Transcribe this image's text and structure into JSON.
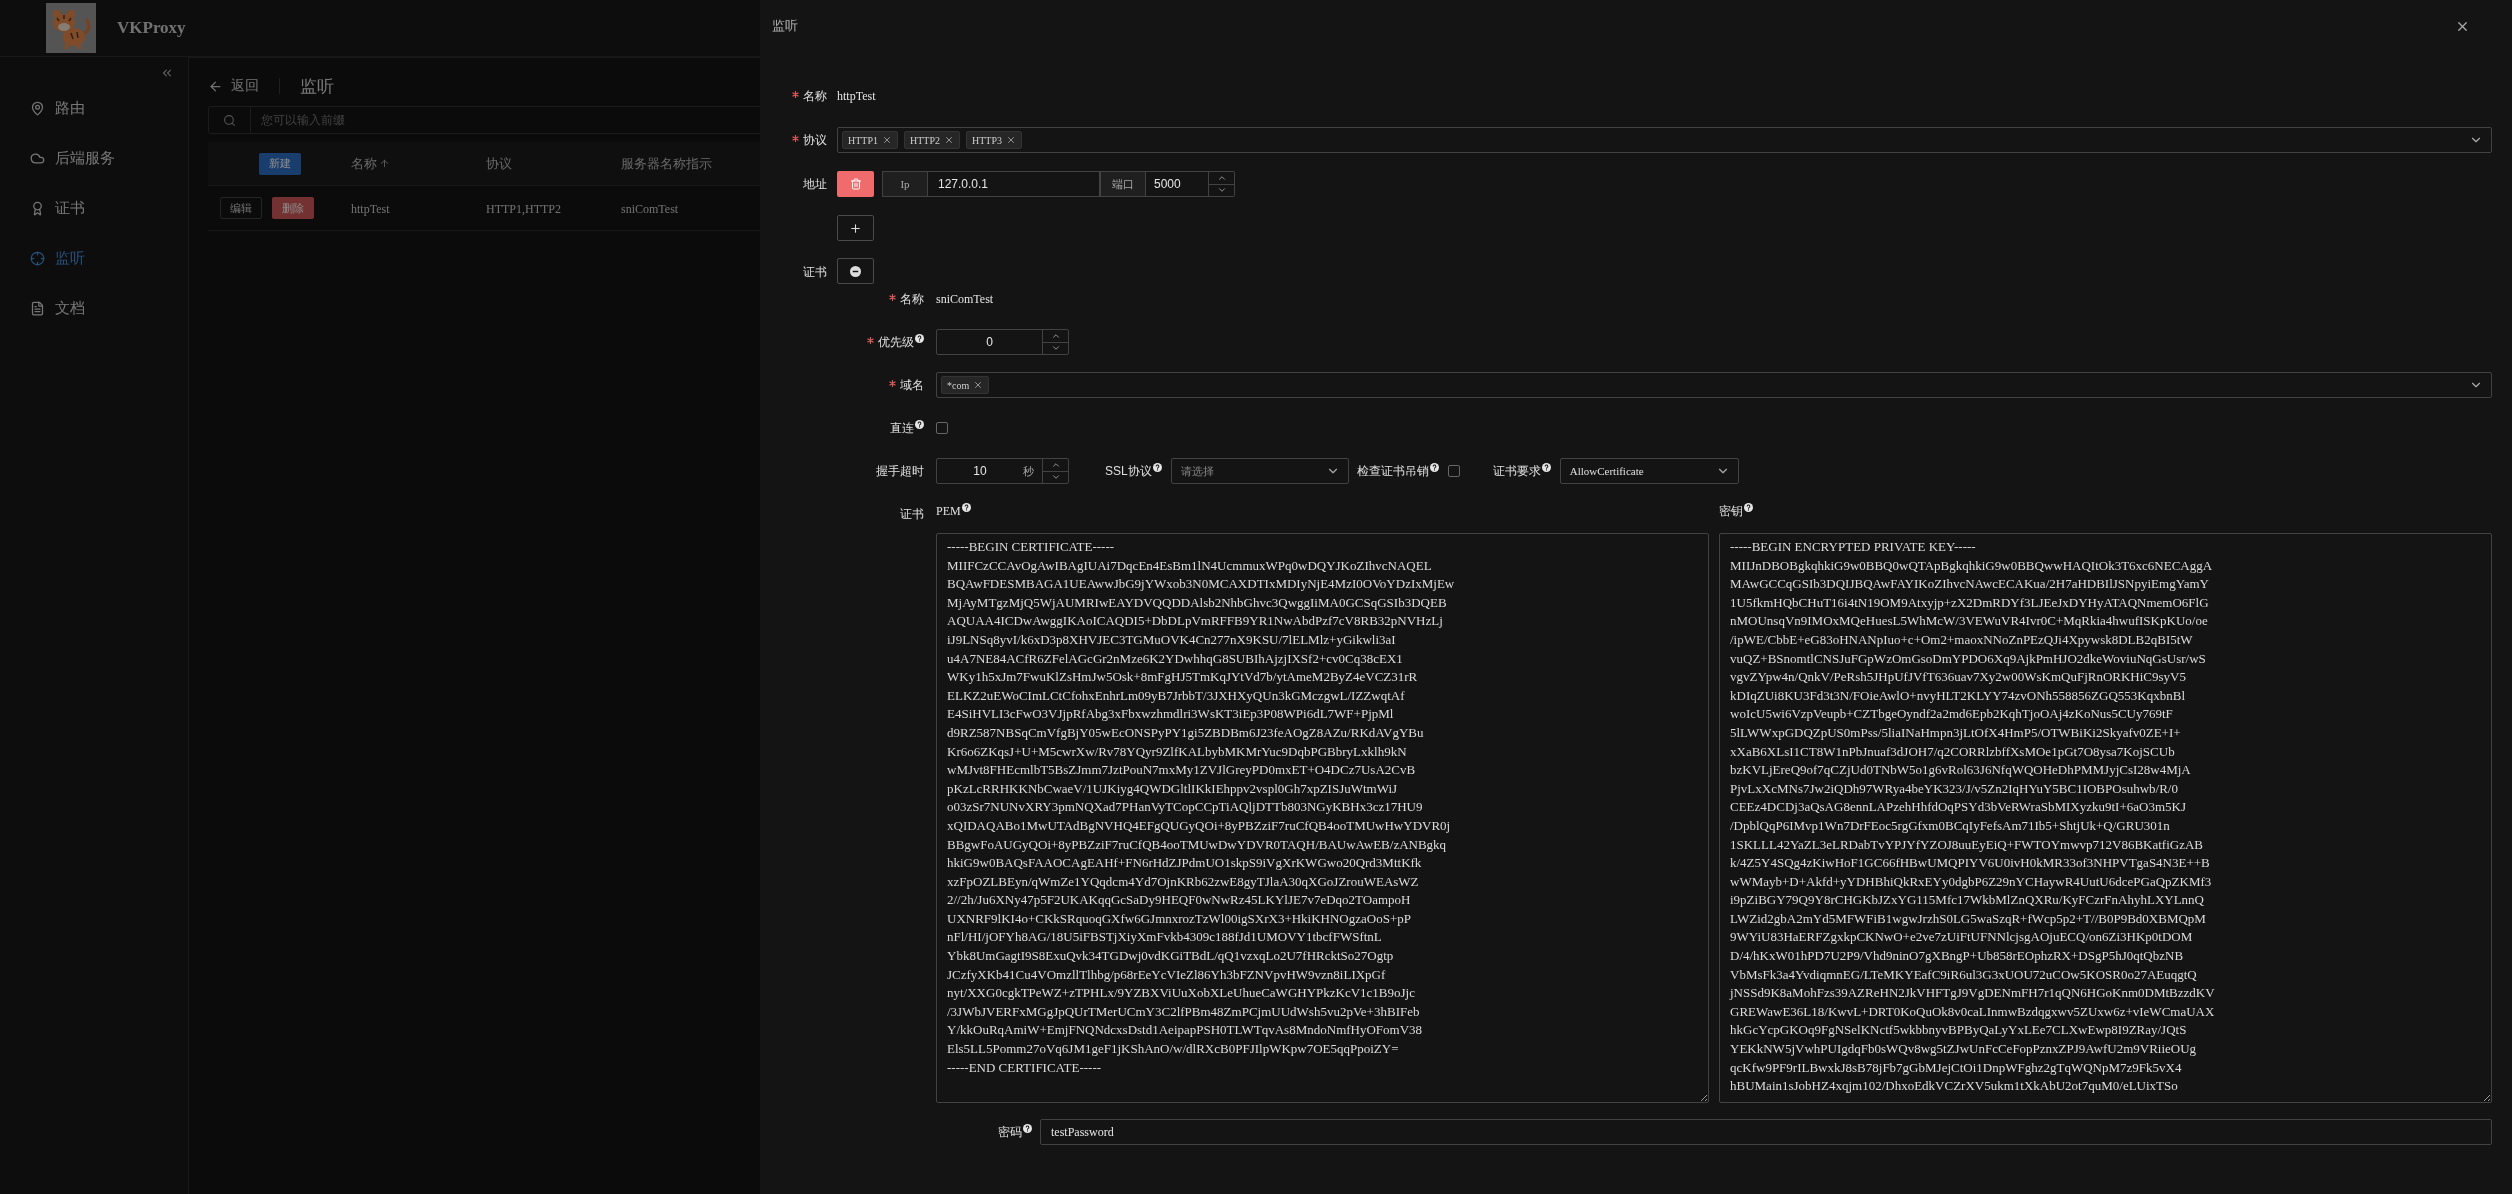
{
  "app": {
    "title": "VKProxy",
    "menu": [
      {
        "label": "路由",
        "selected": false
      },
      {
        "label": "后端服务",
        "selected": false
      },
      {
        "label": "证书",
        "selected": false
      },
      {
        "label": "监听",
        "selected": true
      },
      {
        "label": "文档",
        "selected": false
      }
    ]
  },
  "page": {
    "back": "返回",
    "title": "监听",
    "search": {
      "placeholder": "您可以输入前缀"
    },
    "table": {
      "new_button": "新建",
      "columns": [
        {
          "label": "名称",
          "sorted": true
        },
        {
          "label": "协议",
          "sorted": false
        },
        {
          "label": "服务器名称指示",
          "sorted": false
        }
      ],
      "rows": [
        {
          "edit": "编辑",
          "delete": "删除",
          "cells": [
            "httpTest",
            "HTTP1,HTTP2",
            "sniComTest"
          ]
        }
      ]
    }
  },
  "drawer": {
    "title": "监听",
    "name": {
      "label": {
        "text": "名称",
        "required": true
      },
      "value": "httpTest"
    },
    "protocols": {
      "label": {
        "text": "协议",
        "required": true
      },
      "tags": [
        "HTTP1",
        "HTTP2",
        "HTTP3"
      ]
    },
    "address": {
      "label": {
        "text": "地址"
      },
      "ip_addon": "Ip",
      "ip": "127.0.0.1",
      "port_addon": "端口",
      "port": "5000"
    },
    "certificate": {
      "label": {
        "text": "证书"
      },
      "name": {
        "label": {
          "text": "名称",
          "required": true
        },
        "value": "sniComTest"
      },
      "priority": {
        "label": {
          "text": "优先级",
          "required": true,
          "help": true
        },
        "value": "0"
      },
      "domains": {
        "label": {
          "text": "域名",
          "required": true
        },
        "tags": [
          "*com"
        ]
      },
      "direct": {
        "label": {
          "text": "直连",
          "help": true
        },
        "checked": false
      },
      "handshake_timeout": {
        "label": {
          "text": "握手超时"
        },
        "value": "10",
        "unit": "秒"
      },
      "ssl_protocol": {
        "label": {
          "text": "SSL协议",
          "help": true
        },
        "placeholder": "请选择"
      },
      "check_revocation": {
        "label": {
          "text": "检查证书吊销",
          "help": true
        },
        "checked": false
      },
      "cert_requirement": {
        "label": {
          "text": "证书要求",
          "help": true
        },
        "value": "AllowCertificate"
      },
      "cert_label": {
        "text": "证书"
      },
      "pem": {
        "label": {
          "text": "PEM",
          "help": true
        },
        "lines": [
          "-----BEGIN CERTIFICATE-----",
          "MIIFCzCCAvOgAwIBAgIUAi7DqcEn4EsBm1lN4UcmmuxWPq0wDQYJKoZIhvcNAQEL",
          "BQAwFDESMBAGA1UEAwwJbG9jYWxob3N0MCAXDTIxMDIyNjE4MzI0OVoYDzIxMjEw",
          "MjAyMTgzMjQ5WjAUMRIwEAYDVQQDDAlsb2NhbGhvc3QwggIiMA0GCSqGSIb3DQEB",
          "AQUAA4ICDwAwggIKAoICAQDI5+DbDLpVmRFFB9YR1NwAbdPzf7cV8RB32pNVHzLj",
          "iJ9LNSq8yvI/k6xD3p8XHVJEC3TGMuOVK4Cn277nX9KSU/7lELMlz+yGikwli3aI",
          "u4A7NE84ACfR6ZFelAGcGr2nMze6K2YDwhhqG8SUBIhAjzjIXSf2+cv0Cq38cEX1",
          "WKy1h5xJm7FwuKlZsHmJw5Osk+8mFgHJ5TmKqJYtVd7b/ytAmeM2ByZ4eVCZ31rR",
          "ELKZ2uEWoCImLCtCfohxEnhrLm09yB7JrbbT/3JXHXyQUn3kGMczgwL/IZZwqtAf",
          "E4SiHVLI3cFwO3VJjpRfAbg3xFbxwzhmdlri3WsKT3iEp3P08WPi6dL7WF+PjpMl",
          "d9RZ587NBSqCmVfgBjY05wEcONSPyPY1gi5ZBDBm6J23feAOgZ8AZu/RKdAVgYBu",
          "Kr6o6ZKqsJ+U+M5cwrXw/Rv78YQyr9ZlfKALbybMKMrYuc9DqbPGBbryLxklh9kN",
          "wMJvt8FHEcmlbT5BsZJmm7JztPouN7mxMy1ZVJlGreyPD0mxET+O4DCz7UsA2CvB",
          "pKzLcRRHKKNbCwaeV/1UJKiyg4QWDGltlIKkIEhppv2vspl0Gh7xpZISJuWtmWiJ",
          "o03zSr7NUNvXRY3pmNQXad7PHanVyTCopCCpTiAQljDTTb803NGyKBHx3cz17HU9",
          "xQIDAQABo1MwUTAdBgNVHQ4EFgQUGyQOi+8yPBZziF7ruCfQB4ooTMUwHwYDVR0j",
          "BBgwFoAUGyQOi+8yPBZziF7ruCfQB4ooTMUwDwYDVR0TAQH/BAUwAwEB/zANBgkq",
          "hkiG9w0BAQsFAAOCAgEAHf+FN6rHdZJPdmUO1skpS9iVgXrKWGwo20Qrd3MttKfk",
          "xzFpOZLBEyn/qWmZe1YQqdcm4Yd7OjnKRb62zwE8gyTJlaA30qXGoJZrouWEAsWZ",
          "2//2h/Ju6XNy47p5F2UKAKqqGcSaDy9HEQF0wNwRz45LKYlJE7v7eDqo2TOampoH",
          "UXNRF9lKI4o+CKkSRquoqGXfw6GJmnxrozTzWl00igSXrX3+HkiKHNOgzaOoS+pP",
          "nFl/HI/jOFYh8AG/18U5iFBSTjXiyXmFvkb4309c188fJd1UMOVY1tbcfFWSftnL",
          "Ybk8UmGagtI9S8ExuQvk34TGDwj0vdKGiTBdL/qQ1vzxqLo2U7fHRcktSo27Ogtp",
          "JCzfyXKb41Cu4VOmzllTlhbg/p68rEeYcVIeZl86Yh3bFZNVpvHW9vzn8iLIXpGf",
          "nyt/XXG0cgkTPeWZ+zTPHLx/9YZBXViUuXobXLeUhueCaWGHYPkzKcV1c1B9oJjc",
          "/3JWbJVERFxMGgJpQUrTMerUCmY3C2lfPBm48ZmPCjmUUdWsh5vu2pVe+3hBIFeb",
          "Y/kkOuRqAmiW+EmjFNQNdcxsDstd1AeipapPSH0TLWTqvAs8MndoNmfHyOFomV38",
          "Els5LL5Pomm27oVq6JM1geF1jKShAnO/w/dlRXcB0PFJIlpWKpw7OE5qqPpoiZY=",
          "-----END CERTIFICATE-----"
        ]
      },
      "key": {
        "label": {
          "text": "密钥",
          "help": true
        },
        "lines": [
          "-----BEGIN ENCRYPTED PRIVATE KEY-----",
          "MIIJnDBOBgkqhkiG9w0BBQ0wQTApBgkqhkiG9w0BBQwwHAQItOk3T6xc6NECAggA",
          "MAwGCCqGSIb3DQIJBQAwFAYIKoZIhvcNAwcECAKua/2H7aHDBIlJSNpyiEmgYamY",
          "1U5fkmHQbCHuT16i4tN19OM9Atxyjp+zX2DmRDYf3LJEeJxDYHyATAQNmemO6FlG",
          "nMOUnsqVn9IMOxMQeHuesL5WhMcW/3VEWuVR4Ivr0C+MqRkia4hwufISKpKUo/oe",
          "/ipWE/CbbE+eG83oHNANpIuo+c+Om2+maoxNNoZnPEzQJi4Xpywsk8DLB2qBI5tW",
          "vuQZ+BSnomtlCNSJuFGpWzOmGsoDmYPDO6Xq9AjkPmHJO2dkeWoviuNqGsUsr/wS",
          "vgvZYpw4n/QnkV/PeRsh5JHpUfJVfT636uav7Xy2w00WsKmQuFjRnORKHiC9syV5",
          "kDIqZUi8KU3Fd3t3N/FOieAwlO+nvyHLT2KLYY74zvONh558856ZGQ553KqxbnBl",
          "woIcU5wi6VzpVeupb+CZTbgeOyndf2a2md6Epb2KqhTjoOAj4zKoNus5CUy769tF",
          "5lLWWxpGDQZpUS0mPss/5liaINaHmpn3jLtOfX4HmP5/OTWBiKi2Skyafv0ZE+I+",
          "xXaB6XLsI1CT8W1nPbJnuaf3dJOH7/q2CORRlzbffXsMOe1pGt7O8ysa7KojSCUb",
          "bzKVLjEreQ9of7qCZjUd0TNbW5o1g6vRol63J6NfqWQOHeDhPMMJyjCsI28w4MjA",
          "PjvLxXcMNs7Jw2iQDh97WRya4beYK323/J/v5Zn2IqHYuY5BC1IOBPOsuhwb/R/0",
          "CEEz4DCDj3aQsAG8ennLAPzehHhfdOqPSYd3bVeRWraSbMIXyzku9tI+6aO3m5KJ",
          "/DpblQqP6IMvp1Wn7DrFEoc5rgGfxm0BCqIyFefsAm71Ib5+ShtjUk+Q/GRU301n",
          "1SKLLL42YaZL3eLRDabTvYPJYfYZOJ8uuEyEiQ+FWTOYmwvp712V86BKatfiGzAB",
          "k/4Z5Y4SQg4zKiwHoF1GC66fHBwUMQPIYV6U0ivH0kMR33of3NHPVTgaS4N3E++B",
          "wWMayb+D+Akfd+yYDHBhiQkRxEYy0dgbP6Z29nYCHaywR4UutU6dcePGaQpZKMf3",
          "i9pZiBGY79Q9Y8rCHGKbJZxYG115Mfc17WkbMlZnQXRu/KyFCzrFnAhyhLXYLnnQ",
          "LWZid2gbA2mYd5MFWFiB1wgwJrzhS0LG5waSzqR+fWcp5p2+T//B0P9Bd0XBMQpM",
          "9WYiU83HaERFZgxkpCKNwO+e2ve7zUiFtUFNNlcjsgAOjuECQ/on6Zi3HKp0tDOM",
          "D/4/hKxW01hPD7U2P9/Vhd9ninO7gXBngP+Ub858rEOphzRX+DSgP5hJ0qtQbzNB",
          "VbMsFk3a4YvdiqmnEG/LTeMKYEafC9iR6ul3G3xUOU72uCOw5KOSR0o27AEuqgtQ",
          "jNSSd9K8aMohFzs39AZReHN2JkVHFTgJ9VgDENmFH7r1qQN6HGoKnm0DMtBzzdKV",
          "GREWawE36L18/KwvL+DRT0KoQuOk8v0caLInmwBzdqgxwv5ZUxw6z+vIeWCmaUAX",
          "hkGcYcpGKOq9FgNSelKNctf5wkbbnyvBPByQaLyYxLEe7CLXwEwp8I9ZRay/JQtS",
          "YEKkNW5jVwhPUIgdqFb0sWQv8wg5tZJwUnFcCeFopPznxZPJ9AwfU2m9VRiieOUg",
          "qcKfw9PF9rILBwxkJ8sB78jFb7gGbMJejCtOi1DnpWFghz2gTqWQNpM7z9Fk5vX4",
          "hBUMain1sJobHZ4xqjm102/DhxoEdkVCZrXV5ukm1tXkAbU2ot7quM0/eLUixTSo"
        ]
      },
      "password": {
        "label": {
          "text": "密码",
          "help": true
        },
        "value": "testPassword"
      }
    }
  }
}
